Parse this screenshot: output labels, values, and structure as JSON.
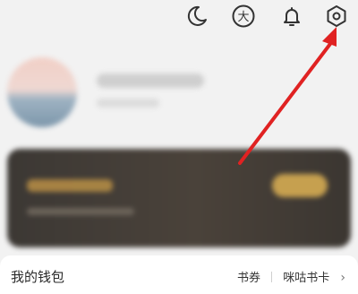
{
  "header": {
    "icons": [
      {
        "name": "moon-icon"
      },
      {
        "name": "da-badge-icon",
        "glyph": "大"
      },
      {
        "name": "bell-icon"
      },
      {
        "name": "settings-icon"
      }
    ]
  },
  "wallet": {
    "title": "我的钱包",
    "links": [
      {
        "label": "书券"
      },
      {
        "label": "咪咕书卡"
      }
    ],
    "chevron": "›"
  },
  "annotation": {
    "color": "#e02222"
  }
}
